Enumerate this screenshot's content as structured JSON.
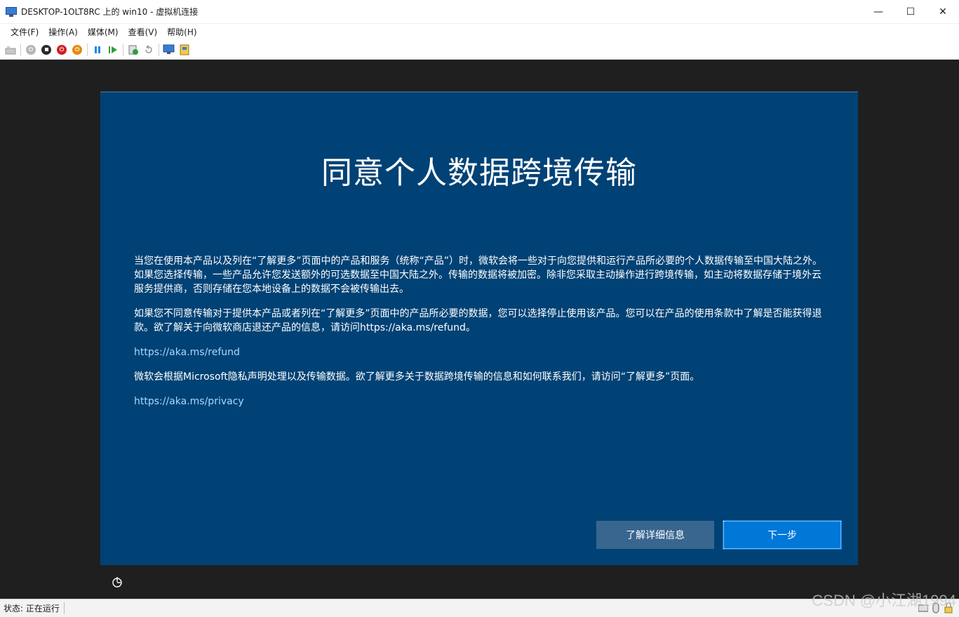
{
  "window": {
    "title": "DESKTOP-1OLT8RC 上的 win10 - 虚拟机连接",
    "minimize": "—",
    "maximize": "☐",
    "close": "✕"
  },
  "menu": {
    "items": [
      "文件(F)",
      "操作(A)",
      "媒体(M)",
      "查看(V)",
      "帮助(H)"
    ]
  },
  "toolbar": {
    "icons": [
      "ctrl-alt-del-icon",
      "start-icon",
      "turn-off-icon",
      "shut-down-icon",
      "save-icon",
      "pause-icon",
      "resume-icon",
      "checkpoint-icon",
      "revert-icon",
      "enhanced-session-icon",
      "share-icon"
    ]
  },
  "oobe": {
    "title": "同意个人数据跨境传输",
    "paragraph1": "当您在使用本产品以及列在“了解更多”页面中的产品和服务（统称“产品”）时，微软会将一些对于向您提供和运行产品所必要的个人数据传输至中国大陆之外。如果您选择传输，一些产品允许您发送额外的可选数据至中国大陆之外。传输的数据将被加密。除非您采取主动操作进行跨境传输，如主动将数据存储于境外云服务提供商，否则存储在您本地设备上的数据不会被传输出去。",
    "paragraph2": "如果您不同意传输对于提供本产品或者列在“了解更多”页面中的产品所必要的数据，您可以选择停止使用该产品。您可以在产品的使用条款中了解是否能获得退款。欲了解关于向微软商店退还产品的信息，请访问https://aka.ms/refund。",
    "link1": "https://aka.ms/refund",
    "paragraph3": "微软会根据Microsoft隐私声明处理以及传输数据。欲了解更多关于数据跨境传输的信息和如何联系我们，请访问“了解更多”页面。",
    "link2": "https://aka.ms/privacy",
    "learn_more_button": "了解详细信息",
    "next_button": "下一步"
  },
  "status": {
    "text": "状态: 正在运行"
  },
  "watermark": "CSDN @小江湖1994"
}
